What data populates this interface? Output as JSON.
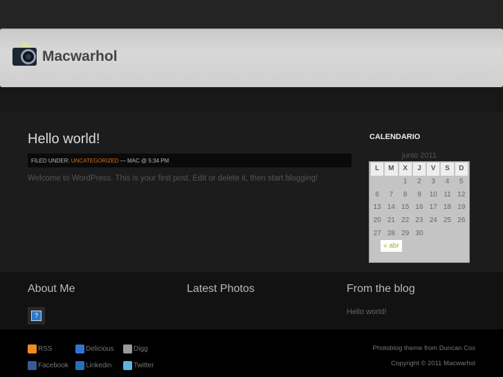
{
  "site": {
    "title": "Macwarhol"
  },
  "post": {
    "title": "Hello world!",
    "meta_prefix": "Filed under:",
    "category": "Uncategorized",
    "meta_suffix": "— Mac @ 5:34 PM",
    "body": "Welcome to WordPress. This is your first post. Edit or delete it, then start blogging!"
  },
  "sidebar": {
    "title": "CALENDARIO",
    "calendar": {
      "caption": "junio 2011",
      "days": [
        "L",
        "M",
        "X",
        "J",
        "V",
        "S",
        "D"
      ],
      "weeks": [
        [
          "",
          "",
          "1",
          "2",
          "3",
          "4",
          "5"
        ],
        [
          "6",
          "7",
          "8",
          "9",
          "10",
          "11",
          "12"
        ],
        [
          "13",
          "14",
          "15",
          "16",
          "17",
          "18",
          "19"
        ],
        [
          "20",
          "21",
          "22",
          "23",
          "24",
          "25",
          "26"
        ],
        [
          "27",
          "28",
          "29",
          "30",
          "",
          "",
          ""
        ]
      ],
      "prev": "« abr"
    }
  },
  "widgets": {
    "about": "About Me",
    "avatar_glyph": "?",
    "photos": "Latest Photos",
    "blog": "From the blog",
    "blog_link": "Hello world!"
  },
  "social": [
    {
      "label": "RSS",
      "color": "#f08a24"
    },
    {
      "label": "Delicious",
      "color": "#3274d1"
    },
    {
      "label": "Digg",
      "color": "#999999"
    },
    {
      "label": "Facebook",
      "color": "#3b5998"
    },
    {
      "label": "Linkedin",
      "color": "#2a6fb5"
    },
    {
      "label": "Twitter",
      "color": "#5ab4e0"
    }
  ],
  "footer": {
    "theme_credit": "Photoblog theme from Duncan Cox",
    "copyright": "Copyright © 2011 Macwarhol"
  }
}
